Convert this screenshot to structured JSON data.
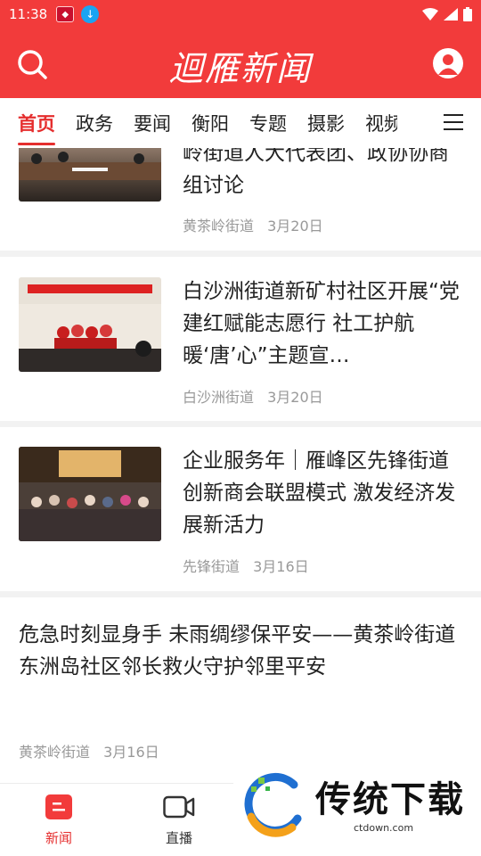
{
  "status_bar": {
    "time": "11:38"
  },
  "header": {
    "logo_text": "迴雁新闻"
  },
  "tabs": [
    {
      "label": "首页",
      "active": true
    },
    {
      "label": "政务"
    },
    {
      "label": "要闻"
    },
    {
      "label": "衡阳"
    },
    {
      "label": "专题"
    },
    {
      "label": "摄影"
    },
    {
      "label": "视频"
    }
  ],
  "feed": [
    {
      "title": "岭街道人大代表团、政协协商组讨论",
      "source": "黄茶岭街道",
      "date": "3月20日"
    },
    {
      "title": "白沙洲街道新矿村社区开展“党建红赋能志愿行 社工护航暖‘唐’心”主题宣…",
      "source": "白沙洲街道",
      "date": "3月20日"
    },
    {
      "title": "企业服务年｜雁峰区先锋街道创新商会联盟模式 激发经济发展新活力",
      "source": "先锋街道",
      "date": "3月16日"
    },
    {
      "title": "危急时刻显身手 未雨绸缪保平安——黄茶岭街道东洲岛社区邻长救火守护邻里平安",
      "source": "黄茶岭街道",
      "date": "3月16日"
    }
  ],
  "bottom_nav": [
    {
      "label": "新闻",
      "active": true
    },
    {
      "label": "直播"
    }
  ],
  "watermark": {
    "brand": "传统下载",
    "url": "ctdown.com"
  },
  "colors": {
    "brand_red": "#f23b3b",
    "active_red": "#e52e2e"
  }
}
